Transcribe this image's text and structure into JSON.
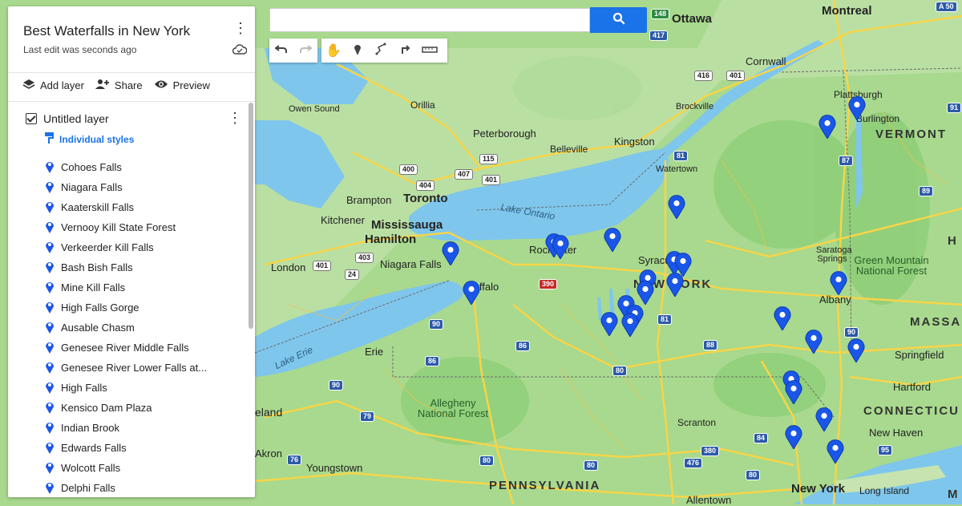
{
  "panel": {
    "title": "Best Waterfalls in New York",
    "subtitle": "Last edit was seconds ago",
    "actions": {
      "add_layer": "Add layer",
      "share": "Share",
      "preview": "Preview"
    },
    "layer": {
      "name": "Untitled layer",
      "styles_label": "Individual styles",
      "items": [
        "Cohoes Falls",
        "Niagara Falls",
        "Kaaterskill Falls",
        "Vernooy Kill State Forest",
        "Verkeerder Kill Falls",
        "Bash Bish Falls",
        "Mine Kill Falls",
        "High Falls Gorge",
        "Ausable Chasm",
        "Genesee River Middle Falls",
        "Genesee River Lower Falls at...",
        "High Falls",
        "Kensico Dam Plaza",
        "Indian Brook",
        "Edwards Falls",
        "Wolcott Falls",
        "Delphi Falls"
      ]
    }
  },
  "search": {
    "placeholder": ""
  },
  "colors": {
    "land": "#a8d98e",
    "water": "#7fc6ec",
    "road": "#f7d548",
    "accent": "#1a73e8",
    "pin": "#1a56e8"
  },
  "map": {
    "labels": {
      "ottawa": "Ottawa",
      "montreal": "Montreal",
      "cornwall": "Cornwall",
      "plattsburgh": "Plattsburgh",
      "burlington": "Burlington",
      "vermont": "VERMONT",
      "owen_sound": "Owen Sound",
      "orillia": "Orillia",
      "peterborough": "Peterborough",
      "belleville": "Belleville",
      "kingston": "Kingston",
      "brockville": "Brockville",
      "watertown": "Watertown",
      "brampton": "Brampton",
      "toronto": "Toronto",
      "kitchener": "Kitchener",
      "mississauga": "Mississauga",
      "hamilton": "Hamilton",
      "london": "London",
      "niagara_falls": "Niagara Falls",
      "lake_ontario": "Lake Ontario",
      "rochester": "Rochester",
      "syracuse": "Syracuse",
      "new_york_state": "NEW YORK",
      "saratoga": "Saratoga Springs",
      "green_mountain": "Green Mountain National Forest",
      "albany": "Albany",
      "h_cut": "H",
      "massa": "MASSA",
      "buffalo": "Buffalo",
      "lake_erie": "Lake Erie",
      "erie": "Erie",
      "springfield": "Springfield",
      "hartford": "Hartford",
      "connecticut": "CONNECTICU",
      "cleveland": "eland",
      "allegheny": "Allegheny National Forest",
      "scranton": "Scranton",
      "new_haven": "New Haven",
      "akron": "Akron",
      "youngstown": "Youngstown",
      "pennsylvania": "PENNSYLVANIA",
      "new_york_city": "New York",
      "long_island": "Long Island",
      "allentown": "Allentown",
      "m_cut": "M",
      "ca_edge": "A"
    },
    "shields": [
      "148",
      "417",
      "416",
      "401",
      "81",
      "87",
      "89",
      "400",
      "404",
      "407",
      "115",
      "401",
      "403",
      "24",
      "401",
      "390",
      "90",
      "86",
      "86",
      "81",
      "88",
      "90",
      "90",
      "80",
      "79",
      "76",
      "80",
      "80",
      "476",
      "380",
      "84",
      "95",
      "80",
      "91",
      "A 50",
      "87"
    ]
  }
}
